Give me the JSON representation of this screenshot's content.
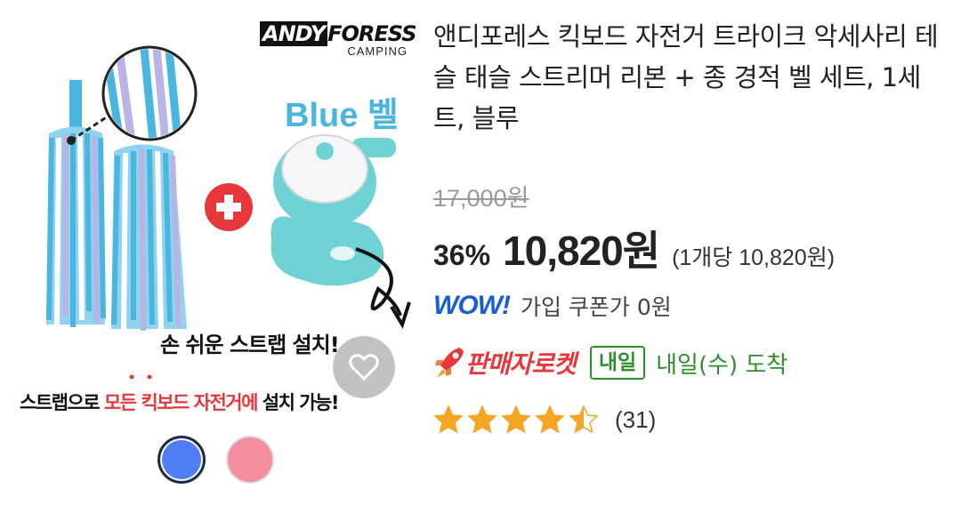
{
  "product_image": {
    "brand_name_box": "ANDY",
    "brand_name_rest": "FORESS",
    "brand_sub": "CAMPING",
    "bell_title": "Blue 벨",
    "strap_text": "손 쉬운 스트랩 설치!",
    "install_pre": "스트랩으로 ",
    "install_highlight": "모든 킥보드 자전거에",
    "install_post": " 설치 가능!",
    "colors": {
      "tassel_blue": "#4ab6e0",
      "tassel_lavender": "#b9b3e6",
      "bell_mint": "#6fd3d6",
      "plus_red": "#e8373a"
    }
  },
  "options": {
    "swatches": [
      {
        "name": "blue",
        "color": "#4f7df3",
        "selected": true
      },
      {
        "name": "pink",
        "color": "#f48d9d",
        "selected": false
      }
    ]
  },
  "product": {
    "title": "앤디포레스 킥보드 자전거 트라이크 악세사리 테슬 태슬 스트리머 리본 + 종 경적 벨 세트, 1세트, 블루",
    "original_price": "17,000원",
    "discount": "36%",
    "sale_price": "10,820원",
    "unit_price": "(1개당 10,820원)",
    "wow_label": "WOW!",
    "coupon_text": "가입 쿠폰가 0원",
    "rocket_label": "판매자로켓",
    "tomorrow_badge": "내일",
    "arrival_text": "내일(수) 도착",
    "rating": 4.5,
    "review_count": "(31)",
    "colors": {
      "discount_red": "#e8373a",
      "wow_blue": "#1a5fd1",
      "delivery_green": "#2f8f2f",
      "star_orange": "#f5a524"
    }
  }
}
